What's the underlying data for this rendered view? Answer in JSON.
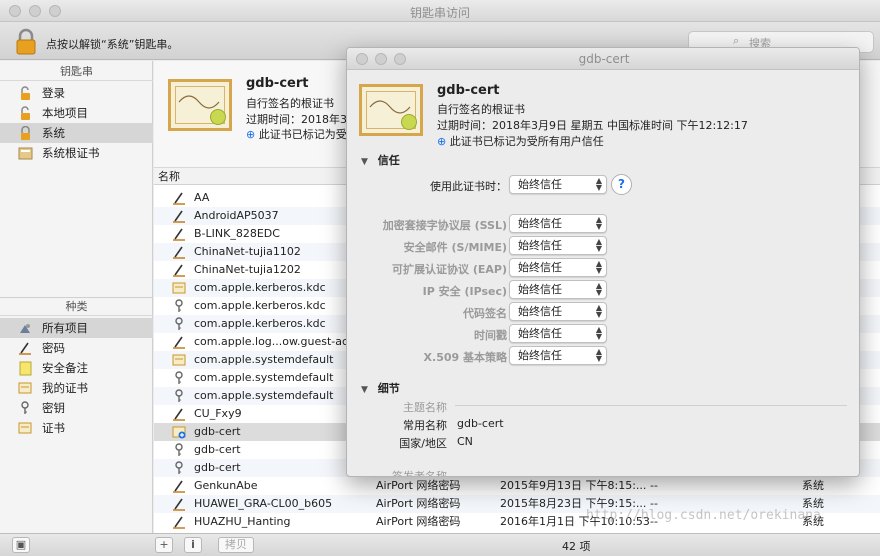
{
  "window": {
    "title": "钥匙串访问"
  },
  "toolbar": {
    "lock_text": "点按以解锁“系统”钥匙串。",
    "search_placeholder": "搜索"
  },
  "sidebar": {
    "keychains_header": "钥匙串",
    "keychains": [
      {
        "label": "登录",
        "icon": "lock-open-icon"
      },
      {
        "label": "本地项目",
        "icon": "lock-open-icon"
      },
      {
        "label": "系统",
        "icon": "lock-icon",
        "selected": true
      },
      {
        "label": "系统根证书",
        "icon": "cabinet-icon"
      }
    ],
    "category_header": "种类",
    "categories": [
      {
        "label": "所有项目",
        "icon": "all-items-icon",
        "selected": true
      },
      {
        "label": "密码",
        "icon": "pen-icon"
      },
      {
        "label": "安全备注",
        "icon": "note-icon"
      },
      {
        "label": "我的证书",
        "icon": "certificate-icon"
      },
      {
        "label": "密钥",
        "icon": "key-icon"
      },
      {
        "label": "证书",
        "icon": "certificate-icon"
      }
    ]
  },
  "detail": {
    "name": "gdb-cert",
    "subtitle": "自行签名的根证书",
    "expiry_prefix": "过期时间：2018年3",
    "trust_note": "此证书已标记为受"
  },
  "list": {
    "name_header": "名称",
    "rows": [
      {
        "name": "AA",
        "icon": "pen-icon",
        "kind": "",
        "date": "",
        "expires": "",
        "keychain": ""
      },
      {
        "name": "AndroidAP5037",
        "icon": "pen-icon",
        "kind": "",
        "date": "",
        "expires": "",
        "keychain": ""
      },
      {
        "name": "B-LINK_828EDC",
        "icon": "pen-icon",
        "kind": "",
        "date": "",
        "expires": "",
        "keychain": ""
      },
      {
        "name": "ChinaNet-tujia1102",
        "icon": "pen-icon",
        "kind": "",
        "date": "",
        "expires": "",
        "keychain": ""
      },
      {
        "name": "ChinaNet-tujia1202",
        "icon": "pen-icon",
        "kind": "",
        "date": "",
        "expires": "",
        "keychain": ""
      },
      {
        "name": "com.apple.kerberos.kdc",
        "icon": "certificate-icon",
        "kind": "",
        "date": "",
        "expires": "",
        "keychain": ""
      },
      {
        "name": "com.apple.kerberos.kdc",
        "icon": "key-icon",
        "kind": "",
        "date": "",
        "expires": "",
        "keychain": ""
      },
      {
        "name": "com.apple.kerberos.kdc",
        "icon": "key-icon",
        "kind": "",
        "date": "",
        "expires": "",
        "keychain": ""
      },
      {
        "name": "com.apple.log...ow.guest-acco",
        "icon": "pen-icon",
        "kind": "",
        "date": "",
        "expires": "",
        "keychain": ""
      },
      {
        "name": "com.apple.systemdefault",
        "icon": "certificate-icon",
        "kind": "",
        "date": "",
        "expires": "",
        "keychain": ""
      },
      {
        "name": "com.apple.systemdefault",
        "icon": "key-icon",
        "kind": "",
        "date": "",
        "expires": "",
        "keychain": ""
      },
      {
        "name": "com.apple.systemdefault",
        "icon": "key-icon",
        "kind": "",
        "date": "",
        "expires": "",
        "keychain": ""
      },
      {
        "name": "CU_Fxy9",
        "icon": "pen-icon",
        "kind": "",
        "date": "",
        "expires": "",
        "keychain": ""
      },
      {
        "name": "gdb-cert",
        "icon": "certificate-plus-icon",
        "kind": "",
        "date": "",
        "expires": "",
        "keychain": "",
        "selected": true
      },
      {
        "name": "gdb-cert",
        "icon": "key-icon",
        "kind": "",
        "date": "",
        "expires": "",
        "keychain": ""
      },
      {
        "name": "gdb-cert",
        "icon": "key-icon",
        "kind": "",
        "date": "",
        "expires": "",
        "keychain": ""
      },
      {
        "name": "GenkunAbe",
        "icon": "pen-icon",
        "kind": "AirPort 网络密码",
        "date": "2015年9月13日 下午8:15:...",
        "expires": "--",
        "keychain": "系统"
      },
      {
        "name": "HUAWEI_GRA-CL00_b605",
        "icon": "pen-icon",
        "kind": "AirPort 网络密码",
        "date": "2015年8月23日 下午9:15:...",
        "expires": "--",
        "keychain": "系统"
      },
      {
        "name": "HUAZHU_Hanting",
        "icon": "pen-icon",
        "kind": "AirPort 网络密码",
        "date": "2016年1月1日 下午10:10:53",
        "expires": "--",
        "keychain": "系统"
      }
    ]
  },
  "status": {
    "count": "42 项",
    "copy_label": "拷贝",
    "watermark": "http://blog.csdn.net/orekinana"
  },
  "cert_window": {
    "title": "gdb-cert",
    "name": "gdb-cert",
    "subtitle": "自行签名的根证书",
    "expiry": "过期时间：2018年3月9日 星期五 中国标准时间 下午12:12:17",
    "trust_note": "此证书已标记为受所有用户信任",
    "trust_header": "信任",
    "use_label": "使用此证书时：",
    "use_value": "始终信任",
    "help_label": "?",
    "policies": [
      {
        "label": "加密套接字协议层 (SSL)",
        "value": "始终信任"
      },
      {
        "label": "安全邮件 (S/MIME)",
        "value": "始终信任"
      },
      {
        "label": "可扩展认证协议 (EAP)",
        "value": "始终信任"
      },
      {
        "label": "IP 安全 (IPsec)",
        "value": "始终信任"
      },
      {
        "label": "代码签名",
        "value": "始终信任"
      },
      {
        "label": "时间戳",
        "value": "始终信任"
      },
      {
        "label": "X.509 基本策略",
        "value": "始终信任"
      }
    ],
    "details_header": "细节",
    "subject_header": "主题名称",
    "common_name_label": "常用名称",
    "common_name_value": "gdb-cert",
    "country_label": "国家/地区",
    "country_value": "CN",
    "issuer_header": "签发者名称"
  },
  "colors": {
    "accent": "#1a73e8",
    "selection": "#dcdcdc"
  }
}
